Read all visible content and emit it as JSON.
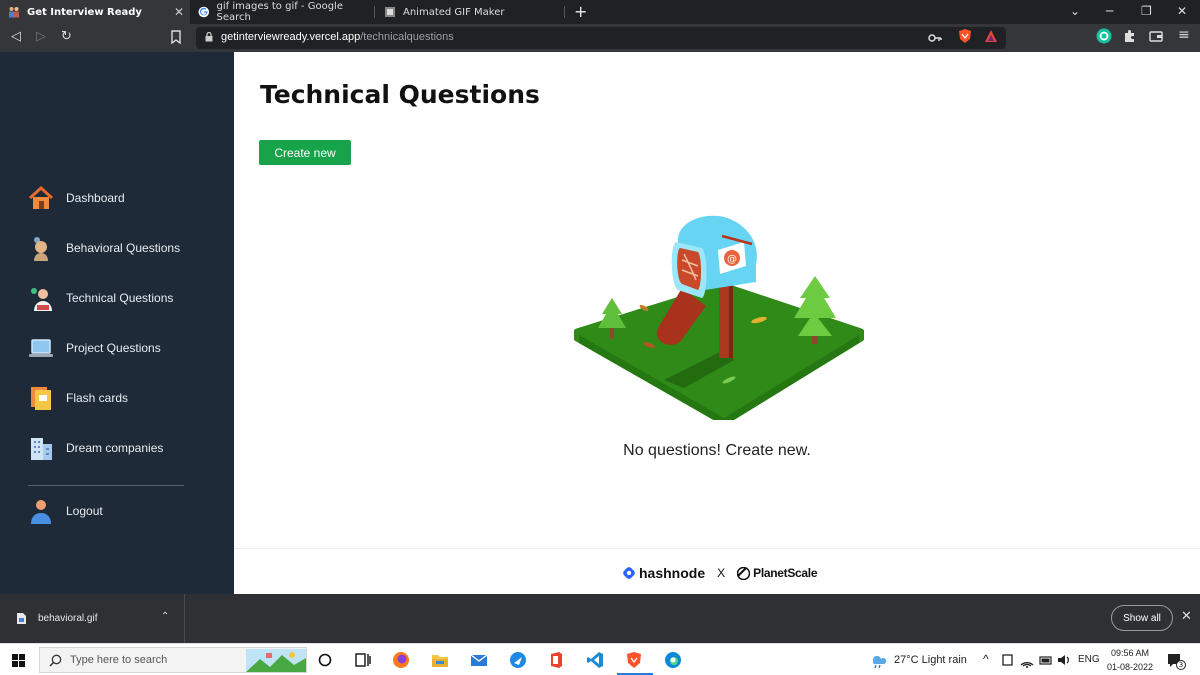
{
  "browser": {
    "tabs": [
      {
        "title": "Get Interview Ready"
      },
      {
        "title": "gif images to gif - Google Search"
      },
      {
        "title": "Animated GIF Maker"
      }
    ],
    "new_tab": "+",
    "url_host": "getinterviewready.vercel.app",
    "url_path": "/technicalquestions"
  },
  "sidebar": {
    "items": [
      {
        "label": "Dashboard"
      },
      {
        "label": "Behavioral Questions"
      },
      {
        "label": "Technical Questions"
      },
      {
        "label": "Project Questions"
      },
      {
        "label": "Flash cards"
      },
      {
        "label": "Dream companies"
      }
    ],
    "logout_label": "Logout"
  },
  "main": {
    "title": "Technical Questions",
    "create_label": "Create new",
    "empty_text": "No questions! Create new."
  },
  "footer": {
    "left": "hashnode",
    "separator": "X",
    "right": "PlanetScale"
  },
  "downloads": {
    "file": "behavioral.gif",
    "show_all": "Show all"
  },
  "taskbar": {
    "search_placeholder": "Type here to search",
    "weather": "27°C  Light rain",
    "lang": "ENG",
    "time": "09:56 AM",
    "date": "01-08-2022",
    "notif_count": "3"
  },
  "colors": {
    "sidebar_bg": "#1f2a38",
    "accent_green": "#16a34a"
  }
}
